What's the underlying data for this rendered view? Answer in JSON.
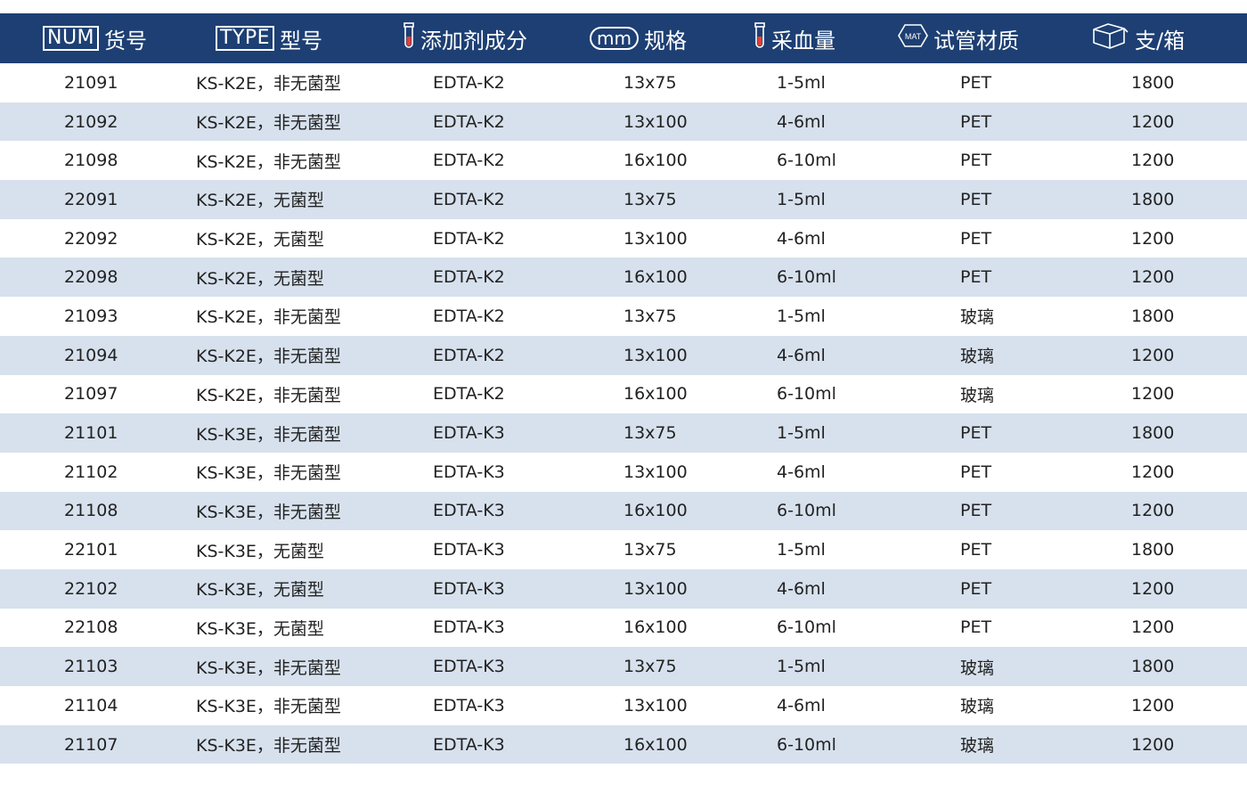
{
  "header": {
    "num_tag": "NUM",
    "num_label": "货号",
    "type_tag": "TYPE",
    "type_label": "型号",
    "additive_label": "添加剂成分",
    "spec_tag": "mm",
    "spec_label": "规格",
    "volume_label": "采血量",
    "material_tag": "MAT",
    "material_label": "试管材质",
    "box_label": "支/箱"
  },
  "colors": {
    "header_bg": "#1d3f73",
    "row_alt": "#d7e1ed"
  },
  "icons": {
    "tube": "test-tube-icon",
    "material": "hexagon-mat-icon",
    "box": "box-icon"
  },
  "rows": [
    [
      "21091",
      "KS-K2E，非无菌型",
      "EDTA-K2",
      "13x75",
      "1-5ml",
      "PET",
      "1800"
    ],
    [
      "21092",
      "KS-K2E，非无菌型",
      "EDTA-K2",
      "13x100",
      "4-6ml",
      "PET",
      "1200"
    ],
    [
      "21098",
      "KS-K2E，非无菌型",
      "EDTA-K2",
      "16x100",
      "6-10ml",
      "PET",
      "1200"
    ],
    [
      "22091",
      "KS-K2E，无菌型",
      "EDTA-K2",
      "13x75",
      "1-5ml",
      "PET",
      "1800"
    ],
    [
      "22092",
      "KS-K2E，无菌型",
      "EDTA-K2",
      "13x100",
      "4-6ml",
      "PET",
      "1200"
    ],
    [
      "22098",
      "KS-K2E，无菌型",
      "EDTA-K2",
      "16x100",
      "6-10ml",
      "PET",
      "1200"
    ],
    [
      "21093",
      "KS-K2E，非无菌型",
      "EDTA-K2",
      "13x75",
      "1-5ml",
      "玻璃",
      "1800"
    ],
    [
      "21094",
      "KS-K2E，非无菌型",
      "EDTA-K2",
      "13x100",
      "4-6ml",
      "玻璃",
      "1200"
    ],
    [
      "21097",
      "KS-K2E，非无菌型",
      "EDTA-K2",
      "16x100",
      "6-10ml",
      "玻璃",
      "1200"
    ],
    [
      "21101",
      "KS-K3E，非无菌型",
      "EDTA-K3",
      "13x75",
      "1-5ml",
      "PET",
      "1800"
    ],
    [
      "21102",
      "KS-K3E，非无菌型",
      "EDTA-K3",
      "13x100",
      "4-6ml",
      "PET",
      "1200"
    ],
    [
      "21108",
      "KS-K3E，非无菌型",
      "EDTA-K3",
      "16x100",
      "6-10ml",
      "PET",
      "1200"
    ],
    [
      "22101",
      "KS-K3E，无菌型",
      "EDTA-K3",
      "13x75",
      "1-5ml",
      "PET",
      "1800"
    ],
    [
      "22102",
      "KS-K3E，无菌型",
      "EDTA-K3",
      "13x100",
      "4-6ml",
      "PET",
      "1200"
    ],
    [
      "22108",
      "KS-K3E，无菌型",
      "EDTA-K3",
      "16x100",
      "6-10ml",
      "PET",
      "1200"
    ],
    [
      "21103",
      "KS-K3E，非无菌型",
      "EDTA-K3",
      "13x75",
      "1-5ml",
      "玻璃",
      "1800"
    ],
    [
      "21104",
      "KS-K3E，非无菌型",
      "EDTA-K3",
      "13x100",
      "4-6ml",
      "玻璃",
      "1200"
    ],
    [
      "21107",
      "KS-K3E，非无菌型",
      "EDTA-K3",
      "16x100",
      "6-10ml",
      "玻璃",
      "1200"
    ]
  ]
}
